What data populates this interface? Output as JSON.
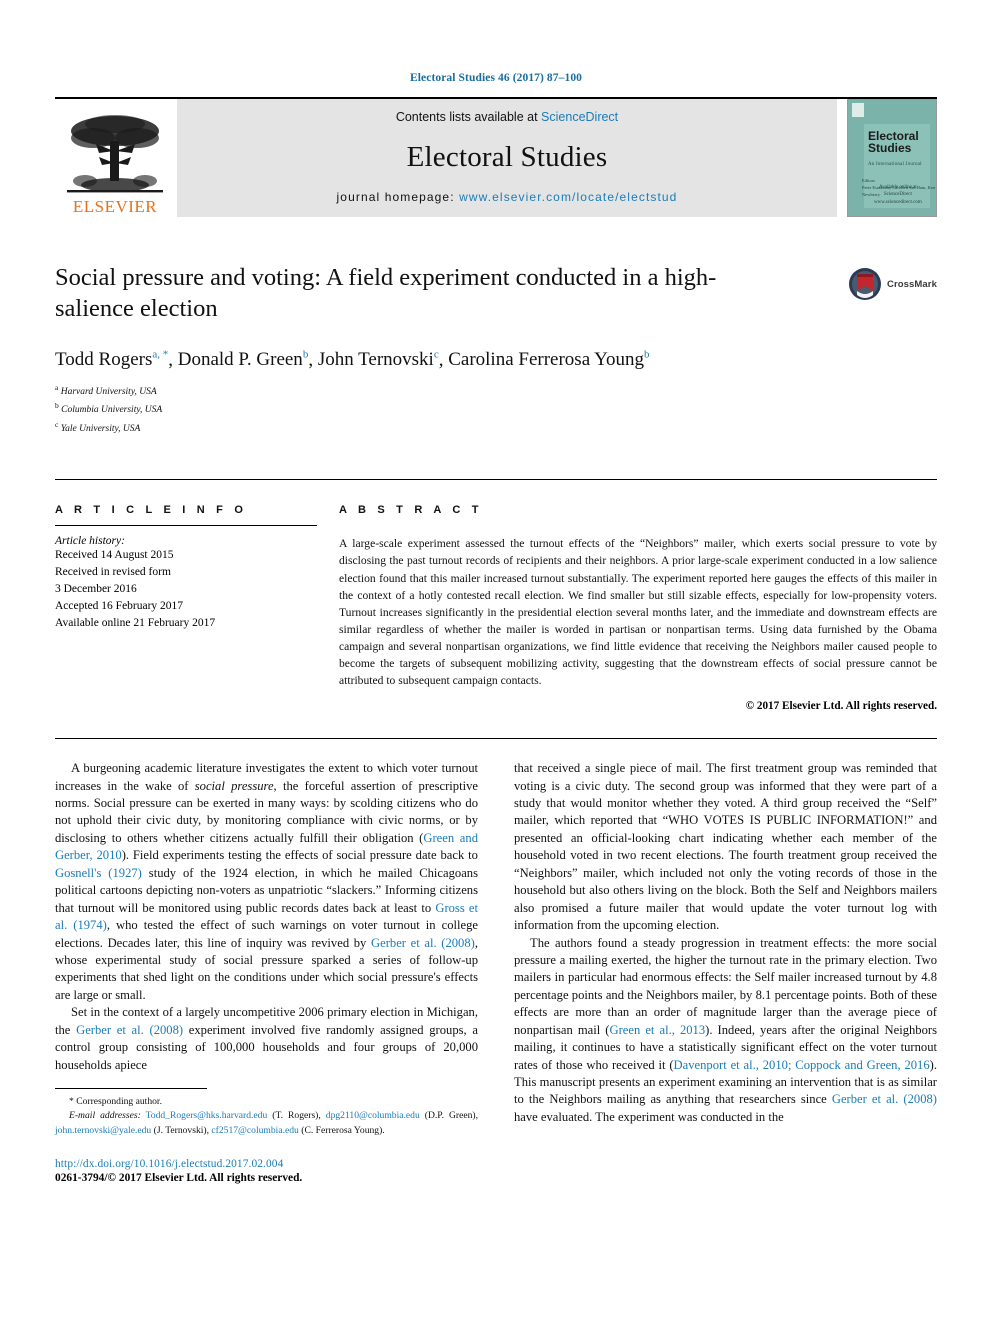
{
  "running_head": "Electoral Studies 46 (2017) 87–100",
  "masthead": {
    "publisher_name": "ELSEVIER",
    "contents_prefix": "Contents lists available at",
    "contents_link": "ScienceDirect",
    "journal_name": "Electoral Studies",
    "homepage_prefix": "journal homepage:",
    "homepage_url": "www.elsevier.com/locate/electstud",
    "cover": {
      "title_line1": "Electoral",
      "title_line2": "Studies",
      "subtitle": "An International Journal",
      "editors": "Editors",
      "editor_names": "Peter Esaiasson, Carolien van Ham, Ken Newberry",
      "available_at": "Available online at",
      "platform": "ScienceDirect",
      "platform_sub": "www.sciencedirect.com"
    }
  },
  "crossmark": {
    "label": "CrossMark"
  },
  "article": {
    "title": "Social pressure and voting: A field experiment conducted in a high-salience election",
    "authors": [
      {
        "name": "Todd Rogers",
        "marks": "a, *"
      },
      {
        "name": "Donald P. Green",
        "marks": "b"
      },
      {
        "name": "John Ternovski",
        "marks": "c"
      },
      {
        "name": "Carolina Ferrerosa Young",
        "marks": "b"
      }
    ],
    "affiliations": [
      {
        "mark": "a",
        "text": "Harvard University, USA"
      },
      {
        "mark": "b",
        "text": "Columbia University, USA"
      },
      {
        "mark": "c",
        "text": "Yale University, USA"
      }
    ]
  },
  "info": {
    "heading": "A R T I C L E   I N F O",
    "history_label": "Article history:",
    "history": [
      "Received 14 August 2015",
      "Received in revised form",
      "3 December 2016",
      "Accepted 16 February 2017",
      "Available online 21 February 2017"
    ]
  },
  "abstract": {
    "heading": "A B S T R A C T",
    "text": "A large-scale experiment assessed the turnout effects of the “Neighbors” mailer, which exerts social pressure to vote by disclosing the past turnout records of recipients and their neighbors. A prior large-scale experiment conducted in a low salience election found that this mailer increased turnout substantially. The experiment reported here gauges the effects of this mailer in the context of a hotly contested recall election. We find smaller but still sizable effects, especially for low-propensity voters. Turnout increases significantly in the presidential election several months later, and the immediate and downstream effects are similar regardless of whether the mailer is worded in partisan or nonpartisan terms. Using data furnished by the Obama campaign and several nonpartisan organizations, we find little evidence that receiving the Neighbors mailer caused people to become the targets of subsequent mobilizing activity, suggesting that the downstream effects of social pressure cannot be attributed to subsequent campaign contacts.",
    "copyright": "© 2017 Elsevier Ltd. All rights reserved."
  },
  "body": {
    "left_para1": {
      "seg1": "A burgeoning academic literature investigates the extent to which voter turnout increases in the wake of ",
      "italic1": "social pressure",
      "seg2": ", the forceful assertion of prescriptive norms. Social pressure can be exerted in many ways: by scolding citizens who do not uphold their civic duty, by monitoring compliance with civic norms, or by disclosing to others whether citizens actually fulfill their obligation (",
      "cite1": "Green and Gerber, 2010",
      "seg3": "). Field experiments testing the effects of social pressure date back to ",
      "cite2": "Gosnell's (1927)",
      "seg4": " study of the 1924 election, in which he mailed Chicagoans political cartoons depicting non-voters as unpatriotic “slackers.” Informing citizens that turnout will be monitored using public records dates back at least to ",
      "cite3": "Gross et al. (1974)",
      "seg5": ", who tested the effect of such warnings on voter turnout in college elections. Decades later, this line of inquiry was revived by ",
      "cite4": "Gerber et al. (2008)",
      "seg6": ", whose experimental study of social pressure sparked a series of follow-up experiments that shed light on the conditions under which social pressure's effects are large or small."
    },
    "left_para2": {
      "seg1": "Set in the context of a largely uncompetitive 2006 primary election in Michigan, the ",
      "cite1": "Gerber et al. (2008)",
      "seg2": " experiment involved five randomly assigned groups, a control group consisting of 100,000 households and four groups of 20,000 households apiece"
    },
    "right_para1": {
      "seg1": "that received a single piece of mail. The first treatment group was reminded that voting is a civic duty. The second group was informed that they were part of a study that would monitor whether they voted. A third group received the “Self” mailer, which reported that “WHO VOTES IS PUBLIC INFORMATION!” and presented an official-looking chart indicating whether each member of the household voted in two recent elections. The fourth treatment group received the “Neighbors” mailer, which included not only the voting records of those in the household but also others living on the block. Both the Self and Neighbors mailers also promised a future mailer that would update the voter turnout log with information from the upcoming election."
    },
    "right_para2": {
      "seg1": "The authors found a steady progression in treatment effects: the more social pressure a mailing exerted, the higher the turnout rate in the primary election. Two mailers in particular had enormous effects: the Self mailer increased turnout by 4.8 percentage points and the Neighbors mailer, by 8.1 percentage points. Both of these effects are more than an order of magnitude larger than the average piece of nonpartisan mail (",
      "cite1": "Green et al., 2013",
      "seg2": "). Indeed, years after the original Neighbors mailing, it continues to have a statistically significant effect on the voter turnout rates of those who received it (",
      "cite2": "Davenport et al., 2010; Coppock and Green, 2016",
      "seg3": "). This manuscript presents an experiment examining an intervention that is as similar to the Neighbors mailing as anything that researchers since ",
      "cite3": "Gerber et al. (2008)",
      "seg4": " have evaluated. The experiment was conducted in the"
    }
  },
  "footnotes": {
    "corresponding": "* Corresponding author.",
    "email_label": "E-mail addresses:",
    "emails": [
      {
        "address": "Todd_Rogers@hks.harvard.edu",
        "person": "(T. Rogers),"
      },
      {
        "address": "dpg2110@columbia.edu",
        "person": "(D.P. Green),"
      },
      {
        "address": "john.ternovski@yale.edu",
        "person": "(J. Ternovski),"
      },
      {
        "address": "cf2517@columbia.edu",
        "person": "(C. Ferrerosa Young)."
      }
    ],
    "doi": "http://dx.doi.org/10.1016/j.electstud.2017.02.004",
    "issn": "0261-3794/© 2017 Elsevier Ltd. All rights reserved."
  }
}
